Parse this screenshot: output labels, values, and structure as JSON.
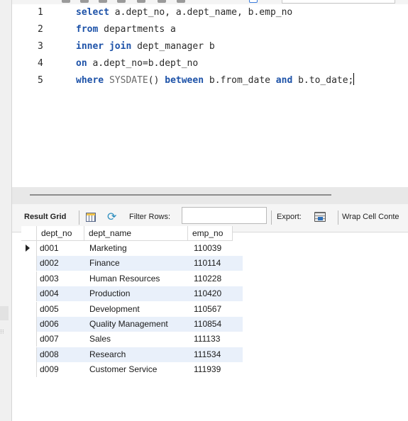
{
  "editor": {
    "lines": [
      {
        "num": "1",
        "tokens": [
          {
            "t": "select",
            "k": "kw"
          },
          {
            "t": " a.dept_no, a.dept_name, b.emp_no",
            "k": "id"
          }
        ]
      },
      {
        "num": "2",
        "tokens": [
          {
            "t": "from",
            "k": "kw"
          },
          {
            "t": " departments a",
            "k": "id"
          }
        ]
      },
      {
        "num": "3",
        "tokens": [
          {
            "t": "inner join",
            "k": "kw"
          },
          {
            "t": " dept_manager b",
            "k": "id"
          }
        ]
      },
      {
        "num": "4",
        "tokens": [
          {
            "t": "on",
            "k": "kw"
          },
          {
            "t": " a.dept_no=b.dept_no",
            "k": "id"
          }
        ]
      },
      {
        "num": "5",
        "tokens": [
          {
            "t": "where",
            "k": "kw"
          },
          {
            "t": " ",
            "k": "id"
          },
          {
            "t": "SYSDATE",
            "k": "fn"
          },
          {
            "t": "() ",
            "k": "id"
          },
          {
            "t": "between",
            "k": "kw"
          },
          {
            "t": " b.from_date ",
            "k": "id"
          },
          {
            "t": "and",
            "k": "kw"
          },
          {
            "t": " b.to_date;",
            "k": "id"
          }
        ]
      }
    ]
  },
  "result_toolbar": {
    "result_grid_label": "Result Grid",
    "filter_rows_label": "Filter Rows:",
    "filter_value": "",
    "export_label": "Export:",
    "wrap_label": "Wrap Cell Conte"
  },
  "grid": {
    "columns": [
      "dept_no",
      "dept_name",
      "emp_no"
    ],
    "rows": [
      [
        "d001",
        "Marketing",
        "110039"
      ],
      [
        "d002",
        "Finance",
        "110114"
      ],
      [
        "d003",
        "Human Resources",
        "110228"
      ],
      [
        "d004",
        "Production",
        "110420"
      ],
      [
        "d005",
        "Development",
        "110567"
      ],
      [
        "d006",
        "Quality Management",
        "110854"
      ],
      [
        "d007",
        "Sales",
        "111133"
      ],
      [
        "d008",
        "Research",
        "111534"
      ],
      [
        "d009",
        "Customer Service",
        "111939"
      ]
    ]
  },
  "colors": {
    "keyword": "#1d52a8",
    "function": "#6a6a6a",
    "alt_row": "#e9f0fa",
    "refresh_icon": "#2e8fbf"
  },
  "icons": [
    "grid-icon",
    "refresh-icon",
    "export-icon",
    "row-pointer-icon"
  ]
}
